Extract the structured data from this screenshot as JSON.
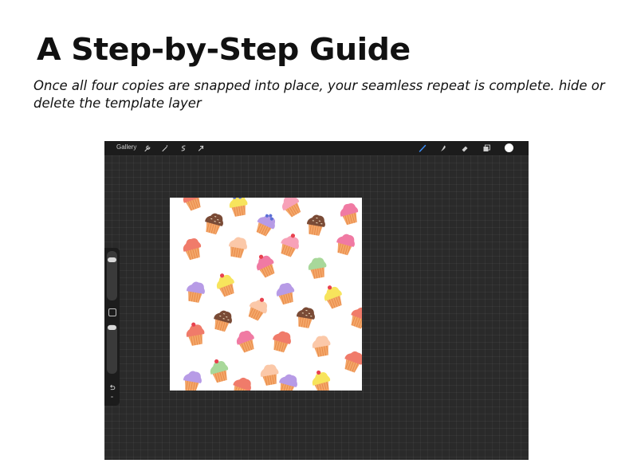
{
  "page": {
    "title": "A Step-by-Step Guide",
    "subtitle": "Once all four copies are snapped into place, your seamless repeat is complete. hide or delete the template layer"
  },
  "app": {
    "gallery_label": "Gallery",
    "left_tools": [
      "wrench-icon",
      "magic-wand-icon",
      "selection-icon",
      "transform-arrow-icon"
    ],
    "right_tools": [
      "brush-icon",
      "smudge-icon",
      "eraser-icon",
      "layers-icon"
    ],
    "active_tool": "brush-icon",
    "accent_color": "#3b8cf5",
    "current_color": "#ffffff",
    "sidebar": [
      "brush-size-slider",
      "modify-button",
      "opacity-slider",
      "undo-icon"
    ]
  },
  "canvas": {
    "pattern": "cupcakes",
    "palette": {
      "wrapper_orange": "#f4a86a",
      "wrapper_stripe": "#e88a4a",
      "frosting_pink": "#f7a1b8",
      "frosting_lilac": "#b79be6",
      "frosting_chocolate": "#7a4b36",
      "frosting_yellow": "#f7e45c",
      "frosting_coral": "#f07b6a",
      "frosting_peach": "#fbc8a8",
      "frosting_mint": "#a8d89a",
      "frosting_hotpink": "#f07aa3",
      "cherry": "#e8424f",
      "blueberry": "#5b6fd6"
    }
  }
}
